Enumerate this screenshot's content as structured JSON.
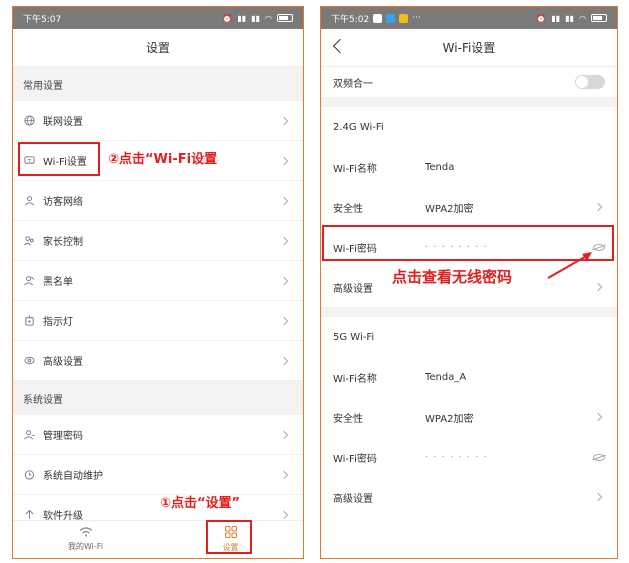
{
  "left": {
    "status": {
      "time": "下午5:07"
    },
    "title": "设置",
    "section1": "常用设置",
    "items1": [
      {
        "label": "联网设置",
        "icon": "globe-icon"
      },
      {
        "label": "Wi-Fi设置",
        "icon": "wifi-settings-icon"
      },
      {
        "label": "访客网络",
        "icon": "guest-icon"
      },
      {
        "label": "家长控制",
        "icon": "parental-icon"
      },
      {
        "label": "黑名单",
        "icon": "blacklist-icon"
      },
      {
        "label": "指示灯",
        "icon": "lamp-icon"
      },
      {
        "label": "高级设置",
        "icon": "advanced-icon"
      }
    ],
    "section2": "系统设置",
    "items2": [
      {
        "label": "管理密码",
        "icon": "key-icon"
      },
      {
        "label": "系统自动维护",
        "icon": "clock-icon"
      },
      {
        "label": "软件升级",
        "icon": "upgrade-icon"
      }
    ],
    "tabs": {
      "wifi": "我的Wi-Fi",
      "settings": "设置"
    },
    "annotation_step2": "②点击“Wi-Fi设置",
    "annotation_step1": "①点击“设置”"
  },
  "right": {
    "status": {
      "time": "下午5:02"
    },
    "title": "Wi-Fi设置",
    "dual_band": "双频合一",
    "band24": {
      "header": "2.4G Wi-Fi",
      "name_label": "Wi-Fi名称",
      "name_value": "Tenda",
      "security_label": "安全性",
      "security_value": "WPA2加密",
      "password_label": "Wi-Fi密码",
      "password_value": "· · · · · · · ·",
      "advanced_label": "高级设置"
    },
    "band5": {
      "header": "5G Wi-Fi",
      "name_label": "Wi-Fi名称",
      "name_value": "Tenda_A",
      "security_label": "安全性",
      "security_value": "WPA2加密",
      "password_label": "Wi-Fi密码",
      "password_value": "· · · · · · · ·",
      "advanced_label": "高级设置"
    },
    "annotation": "点击查看无线密码"
  },
  "colors": {
    "accent": "#e07a30",
    "annotation": "#e02020"
  }
}
